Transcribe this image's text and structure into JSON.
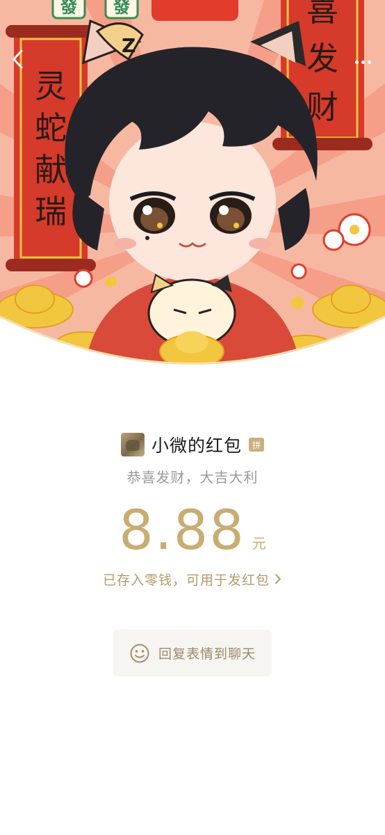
{
  "header": {
    "back_icon": "chevron-left-icon",
    "more_icon": "more-dots-icon",
    "scroll_left_text": [
      "灵",
      "蛇",
      "献",
      "瑞"
    ],
    "scroll_right_text": [
      "喜",
      "发",
      "财"
    ],
    "tile_text": [
      "發",
      "發"
    ],
    "colors": {
      "bg": "#f7b8a2",
      "ray": "#f59a84",
      "scroll_red": "#d63a2a",
      "gold": "#f3c640"
    }
  },
  "packet": {
    "sender_name": "小微的红包",
    "pin_badge": "拼",
    "greeting": "恭喜发财，大吉大利",
    "amount": "8.88",
    "unit": "元",
    "saved_note": "已存入零钱，可用于发红包",
    "saved_note_icon": "chevron-right-icon"
  },
  "reply": {
    "label": "回复表情到聊天",
    "icon": "smiley-icon"
  },
  "colors": {
    "amount_gold": "#c8ad73",
    "greeting_grey": "#9a9a9a",
    "button_bg": "#f6f5f2"
  }
}
